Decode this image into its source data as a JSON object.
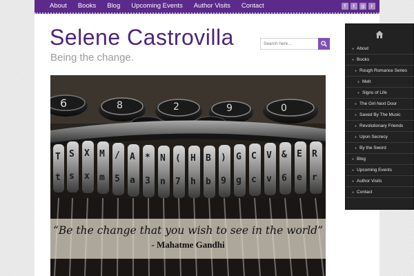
{
  "nav": {
    "items": [
      {
        "label": "About"
      },
      {
        "label": "Books"
      },
      {
        "label": "Blog"
      },
      {
        "label": "Upcoming Events"
      },
      {
        "label": "Author Visits"
      },
      {
        "label": "Contact"
      }
    ]
  },
  "social": {
    "icons": [
      "facebook-icon",
      "twitter-icon",
      "google-plus-icon",
      "rss-icon"
    ],
    "glyphs": [
      "f",
      "t",
      "g",
      "r"
    ]
  },
  "header": {
    "title": "Selene Castrovilla",
    "tagline": "Being the change."
  },
  "search": {
    "placeholder": "Search here..."
  },
  "hero": {
    "quote": "“Be the change that you wish to see in the world”",
    "author": "- Mahatme Gandhi"
  },
  "sidebar": {
    "items": [
      {
        "label": "About",
        "level": 1
      },
      {
        "label": "Books",
        "level": 1
      },
      {
        "label": "Rough Romance Series",
        "level": 2
      },
      {
        "label": "Melt",
        "level": 3
      },
      {
        "label": "Signs of Life",
        "level": 3
      },
      {
        "label": "The Girl Next Door",
        "level": 2
      },
      {
        "label": "Saved By The Music",
        "level": 2
      },
      {
        "label": "Revolutionary Friends",
        "level": 2
      },
      {
        "label": "Upon Secrecy",
        "level": 2
      },
      {
        "label": "By the Sword",
        "level": 2
      },
      {
        "label": "Blog",
        "level": 1
      },
      {
        "label": "Upcoming Events",
        "level": 1
      },
      {
        "label": "Author Visits",
        "level": 1
      },
      {
        "label": "Contact",
        "level": 1
      }
    ]
  },
  "colors": {
    "brand_purple": "#5b2a8a",
    "title_purple": "#4e2479",
    "search_button": "#7e51b3",
    "sidebar_bg": "#222222"
  }
}
